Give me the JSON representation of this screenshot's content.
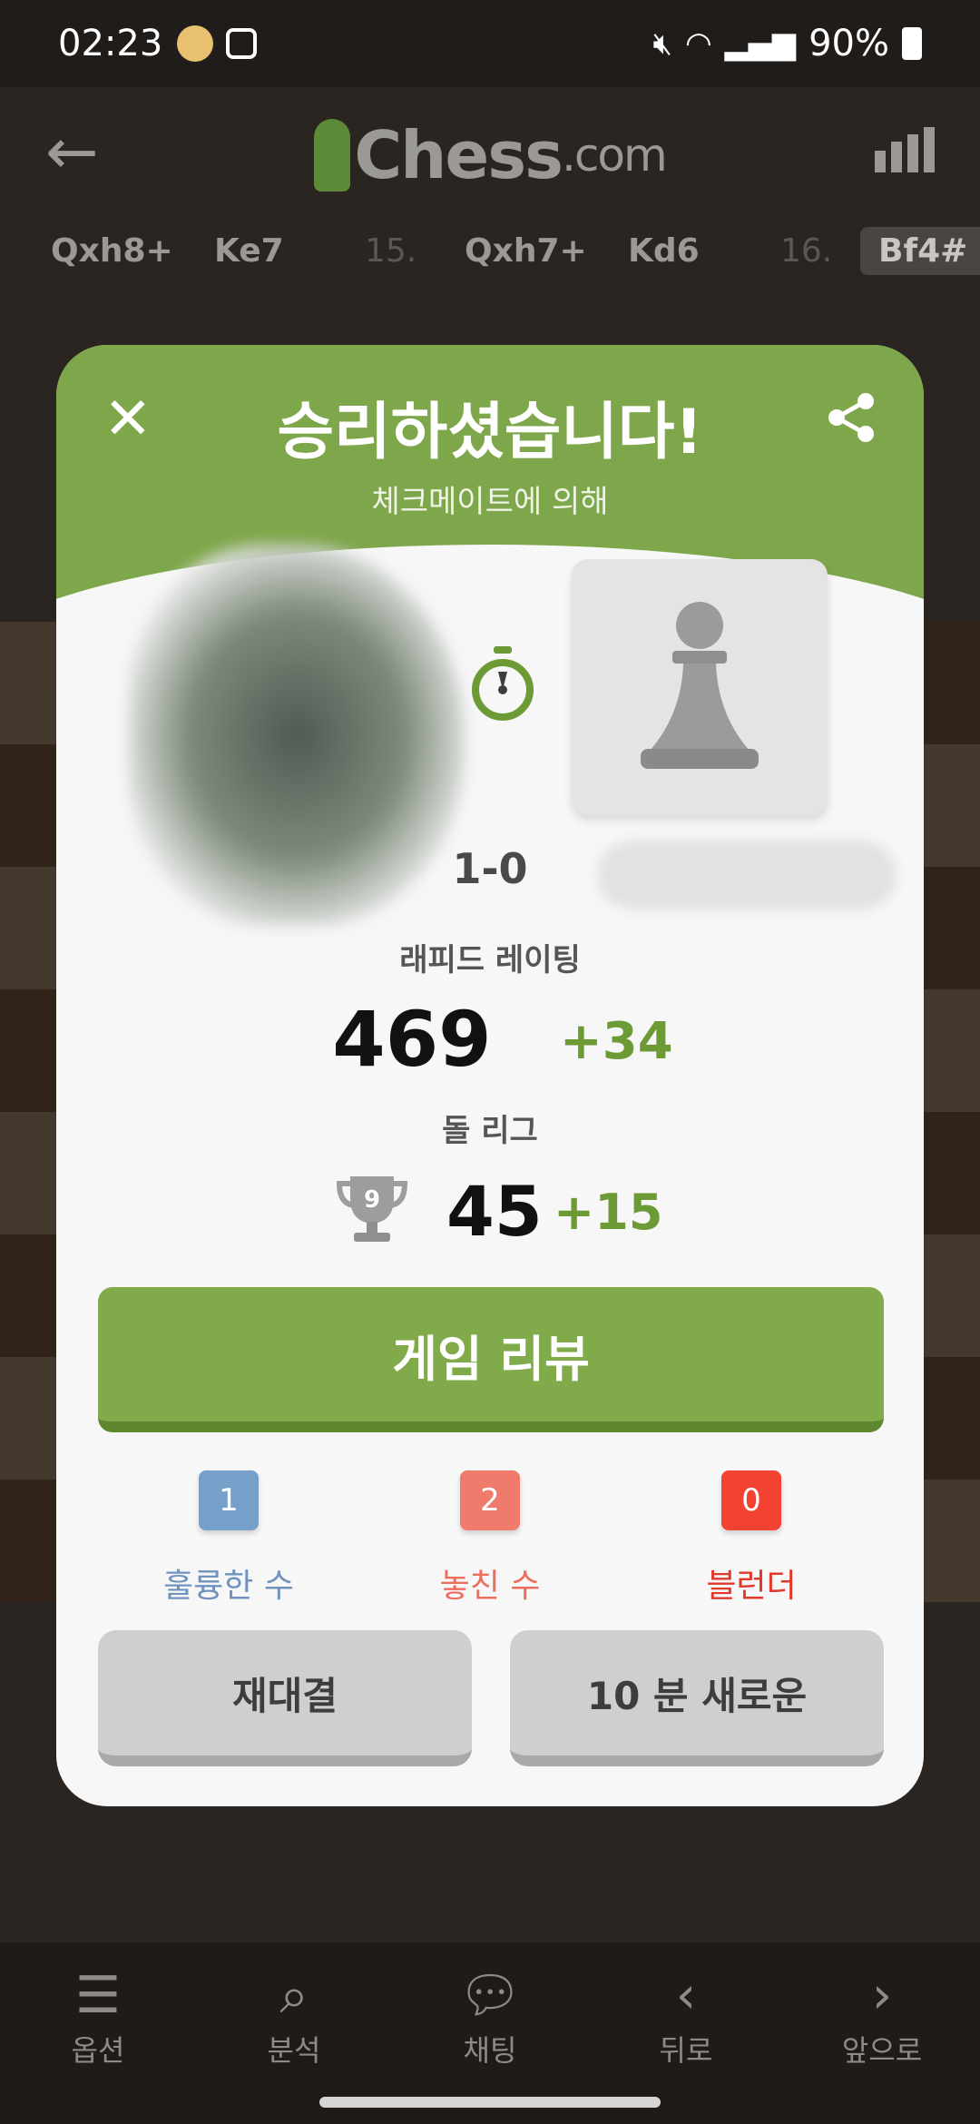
{
  "status_bar": {
    "time": "02:23",
    "battery": "90%"
  },
  "header": {
    "logo_main": "Chess",
    "logo_suffix": ".com"
  },
  "moves": {
    "items": [
      "Qxh8+",
      "Ke7",
      "15.",
      "Qxh7+",
      "Kd6",
      "16.",
      "Bf4#"
    ]
  },
  "modal": {
    "title": "승리하셨습니다!",
    "subtitle": "체크메이트에 의해",
    "score": "1-0",
    "rating_label": "래피드 레이팅",
    "rating_value": "469",
    "rating_delta": "+34",
    "league_label": "돌 리그",
    "league_rank": "9",
    "league_value": "45",
    "league_delta": "+15",
    "review_button": "게임 리뷰",
    "stats": {
      "great": {
        "count": "1",
        "label": "훌륭한 수",
        "color": "#769fca"
      },
      "miss": {
        "count": "2",
        "label": "놓친 수",
        "color": "#f07a6b"
      },
      "blunder": {
        "count": "0",
        "label": "블런더",
        "color": "#f44232"
      }
    },
    "rematch_button": "재대결",
    "new_game_button": "10 분 새로운"
  },
  "bottom_nav": {
    "items": [
      {
        "label": "옵션",
        "icon": "list-icon"
      },
      {
        "label": "분석",
        "icon": "analysis-icon"
      },
      {
        "label": "채팅",
        "icon": "chat-icon"
      },
      {
        "label": "뒤로",
        "icon": "chevron-left-icon"
      },
      {
        "label": "앞으로",
        "icon": "chevron-right-icon"
      }
    ]
  },
  "colors": {
    "brand_green": "#81aa4a",
    "header_green": "#7ea64a",
    "background": "#2b2521"
  }
}
